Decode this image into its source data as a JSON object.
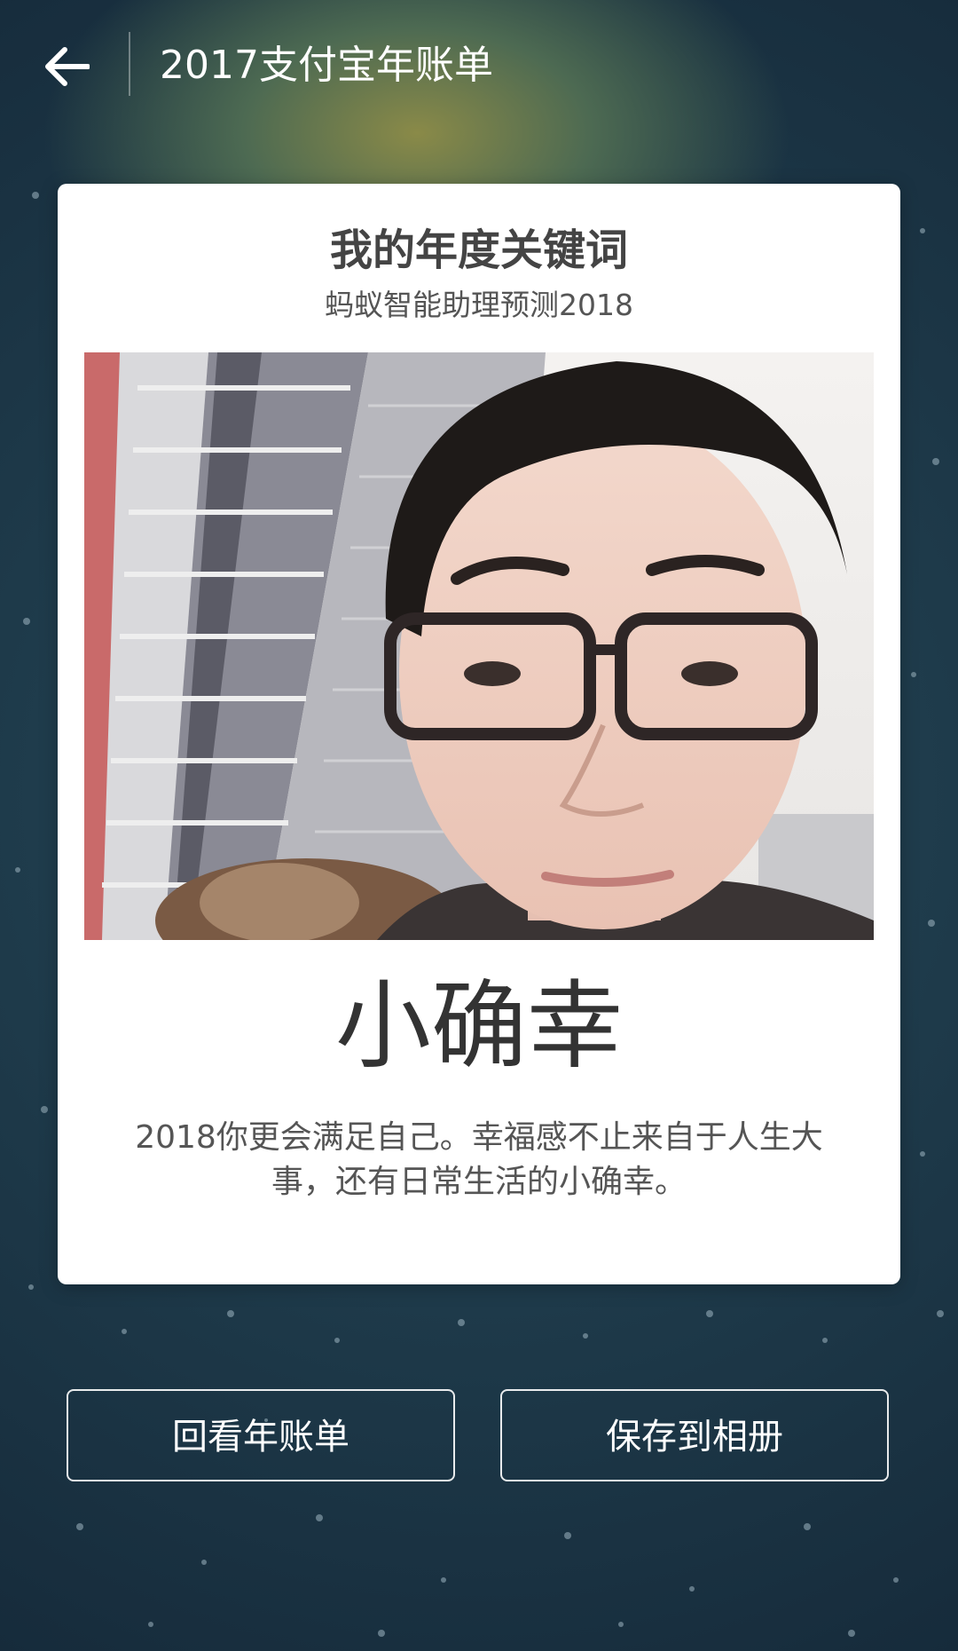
{
  "header": {
    "title": "2017支付宝年账单"
  },
  "card": {
    "title": "我的年度关键词",
    "subtitle": "蚂蚁智能助理预测2018",
    "keyword": "小确幸",
    "description": "2018你更会满足自己。幸福感不止来自于人生大事，还有日常生活的小确幸。"
  },
  "actions": {
    "review_label": "回看年账单",
    "save_label": "保存到相册"
  },
  "colors": {
    "background": "#1d3447",
    "card": "#ffffff",
    "button_border": "#ffffff"
  }
}
